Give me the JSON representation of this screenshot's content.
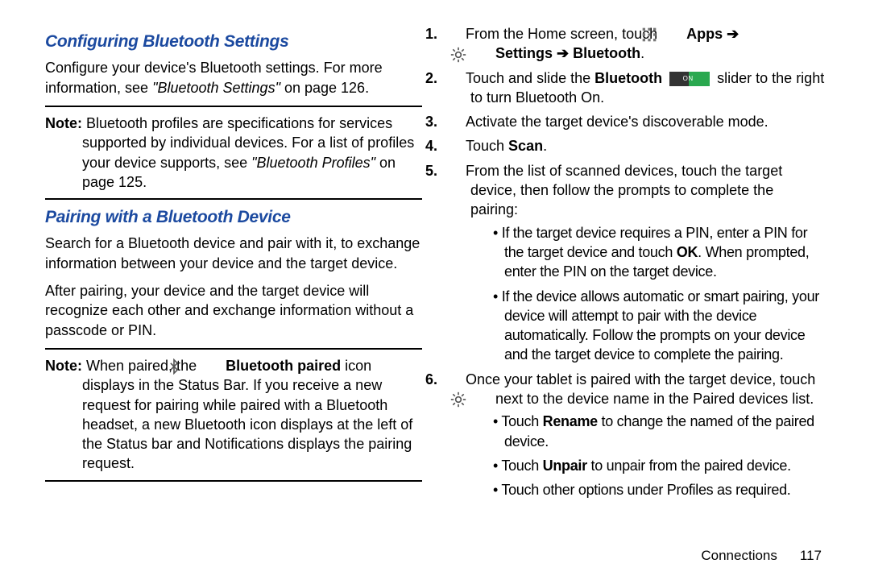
{
  "left": {
    "h1": "Configuring Bluetooth Settings",
    "p1a": "Configure your device's Bluetooth settings. For more information, see ",
    "p1ref": "\"Bluetooth Settings\"",
    "p1b": " on page 126.",
    "noteLabel": "Note:",
    "note1": " Bluetooth profiles are specifications for services supported by individual devices. For a list of profiles your device supports, see ",
    "note1ref": "\"Bluetooth Profiles\"",
    "note1b": " on page 125.",
    "h2": "Pairing with a Bluetooth Device",
    "p2": "Search for a Bluetooth device and pair with it, to exchange information between your device and the target device.",
    "p3": "After pairing, your device and the target device will recognize each other and exchange information without a passcode or PIN.",
    "note2a": " When paired, the ",
    "note2bold": "Bluetooth paired",
    "note2b": " icon displays in the Status Bar. If you receive a new request for pairing while paired with a Bluetooth headset, a new Bluetooth icon displays at the left of the Status bar and Notifications displays the pairing request."
  },
  "right": {
    "steps": {
      "s1a": "From the Home screen, touch ",
      "s1apps": "Apps",
      "s1arrow1": " ➔ ",
      "s1settings": "Settings",
      "s1arrow2": " ➔ ",
      "s1bt": "Bluetooth",
      "s1dot": ".",
      "s2a": "Touch and slide the ",
      "s2bt": "Bluetooth",
      "s2b": " slider to the right to turn Bluetooth On.",
      "switchOnLabel": "ON",
      "s3": "Activate the target device's discoverable mode.",
      "s4a": "Touch ",
      "s4scan": "Scan",
      "s4b": ".",
      "s5": "From the list of scanned devices, touch the target device, then follow the prompts to complete the pairing:",
      "b1a": "If the target device requires a PIN, enter a PIN for the target device and touch ",
      "b1ok": "OK",
      "b1b": ". When prompted, enter the PIN on the target device.",
      "b2": "If the device allows automatic or smart pairing, your device will attempt to pair with the device automatically. Follow the prompts on your device and the target device to complete the pairing.",
      "s6a": "Once your tablet is paired with the target device, touch ",
      "s6b": " next to the device name in the Paired devices list.",
      "b3a": "Touch ",
      "b3rename": "Rename",
      "b3b": " to change the named of the paired device.",
      "b4a": "Touch ",
      "b4unpair": "Unpair",
      "b4b": " to unpair from the paired device.",
      "b5": "Touch other options under Profiles as required."
    }
  },
  "footer": {
    "section": "Connections",
    "page": "117"
  }
}
